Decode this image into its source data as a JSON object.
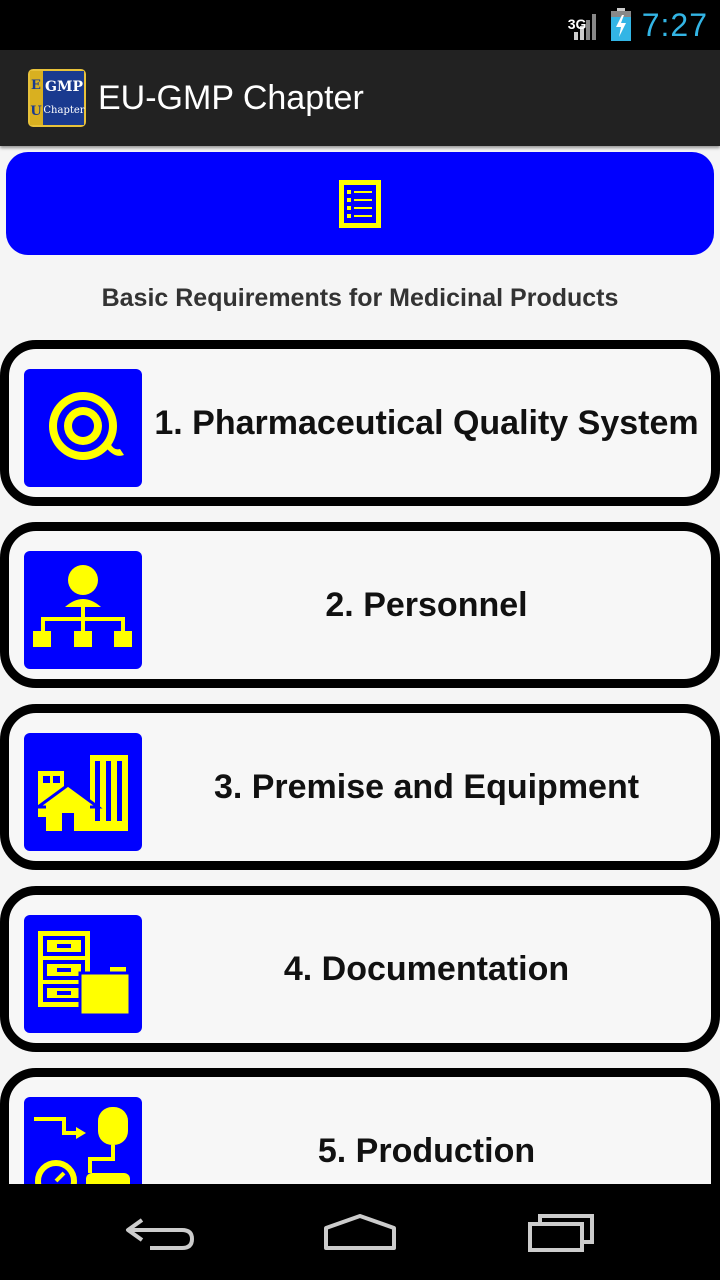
{
  "status_bar": {
    "network": "3G",
    "time": "7:27"
  },
  "action_bar": {
    "title": "EU-GMP Chapter",
    "logo_text_top": "GMP",
    "logo_text_bottom": "Chapter",
    "logo_side_top": "E",
    "logo_side_bottom": "U"
  },
  "top_button": {
    "icon": "list-icon"
  },
  "subtitle": "Basic Requirements for Medicinal Products",
  "chapters": [
    {
      "label": "1. Pharmaceutical Quality System",
      "icon": "quality-icon"
    },
    {
      "label": "2. Personnel",
      "icon": "org-chart-icon"
    },
    {
      "label": "3. Premise and Equipment",
      "icon": "building-icon"
    },
    {
      "label": "4. Documentation",
      "icon": "file-cabinet-icon"
    },
    {
      "label": "5. Production",
      "icon": "production-icon"
    }
  ],
  "colors": {
    "accent_blue": "#0000ff",
    "icon_yellow": "#ffff00",
    "clock": "#33b5e5"
  }
}
